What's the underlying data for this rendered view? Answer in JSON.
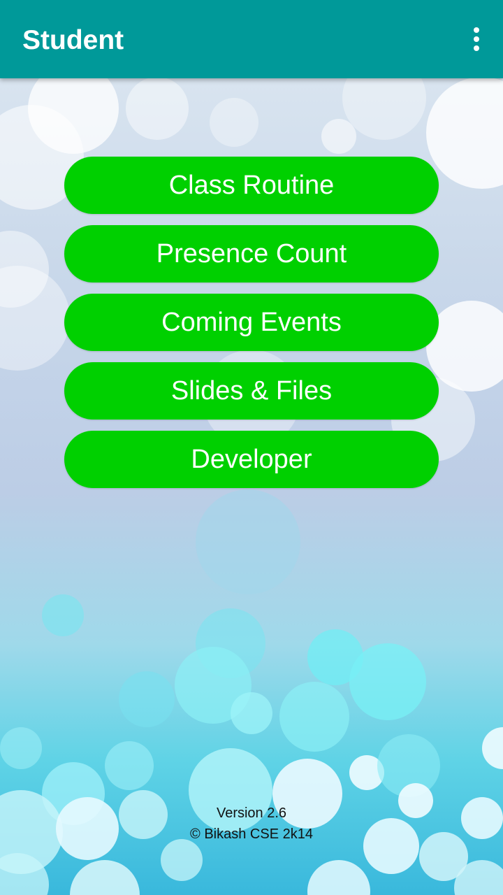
{
  "app_bar": {
    "title": "Student",
    "background_color": "#009999",
    "overflow_icon": "more-vert-icon"
  },
  "menu": {
    "button_color": "#00d000",
    "items": [
      {
        "label": "Class Routine"
      },
      {
        "label": "Presence Count"
      },
      {
        "label": "Coming Events"
      },
      {
        "label": "Slides & Files"
      },
      {
        "label": "Developer"
      }
    ]
  },
  "footer": {
    "version": "Version 2.6",
    "copyright": "© Bikash CSE 2k14"
  }
}
